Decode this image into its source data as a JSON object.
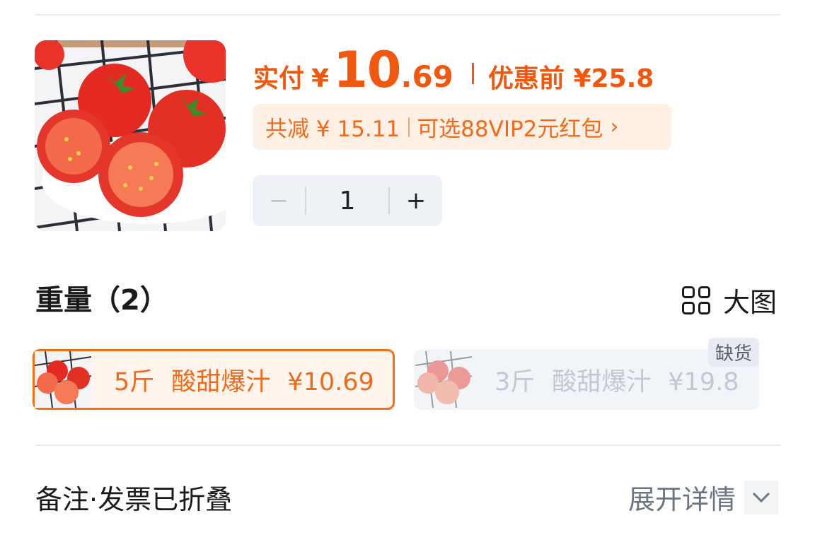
{
  "product": {
    "image_alt": "tomatoes"
  },
  "price": {
    "label": "实付",
    "currency": "¥",
    "integer": "10",
    "decimal": ".69",
    "before_label": "优惠前 ¥25.8"
  },
  "discount": {
    "total": "共减 ¥ 15.11",
    "coupon": "可选88VIP2元红包",
    "chevron": "›"
  },
  "stepper": {
    "minus": "−",
    "value": "1",
    "plus": "+"
  },
  "weight": {
    "title": "重量（2）",
    "big_view": "大图",
    "options": [
      {
        "weight": "5斤",
        "desc": "酸甜爆汁",
        "price": "¥10.69",
        "selected": true,
        "available": true
      },
      {
        "weight": "3斤",
        "desc": "酸甜爆汁",
        "price": "¥19.8",
        "selected": false,
        "available": false,
        "badge": "缺货"
      }
    ]
  },
  "notes": {
    "label": "备注·发票已折叠",
    "expand": "展开详情"
  },
  "colors": {
    "accent": "#f0570f",
    "discount_bg": "#fff0e6",
    "stepper_bg": "#eef2f7",
    "disabled_text": "#c2c8d0"
  }
}
